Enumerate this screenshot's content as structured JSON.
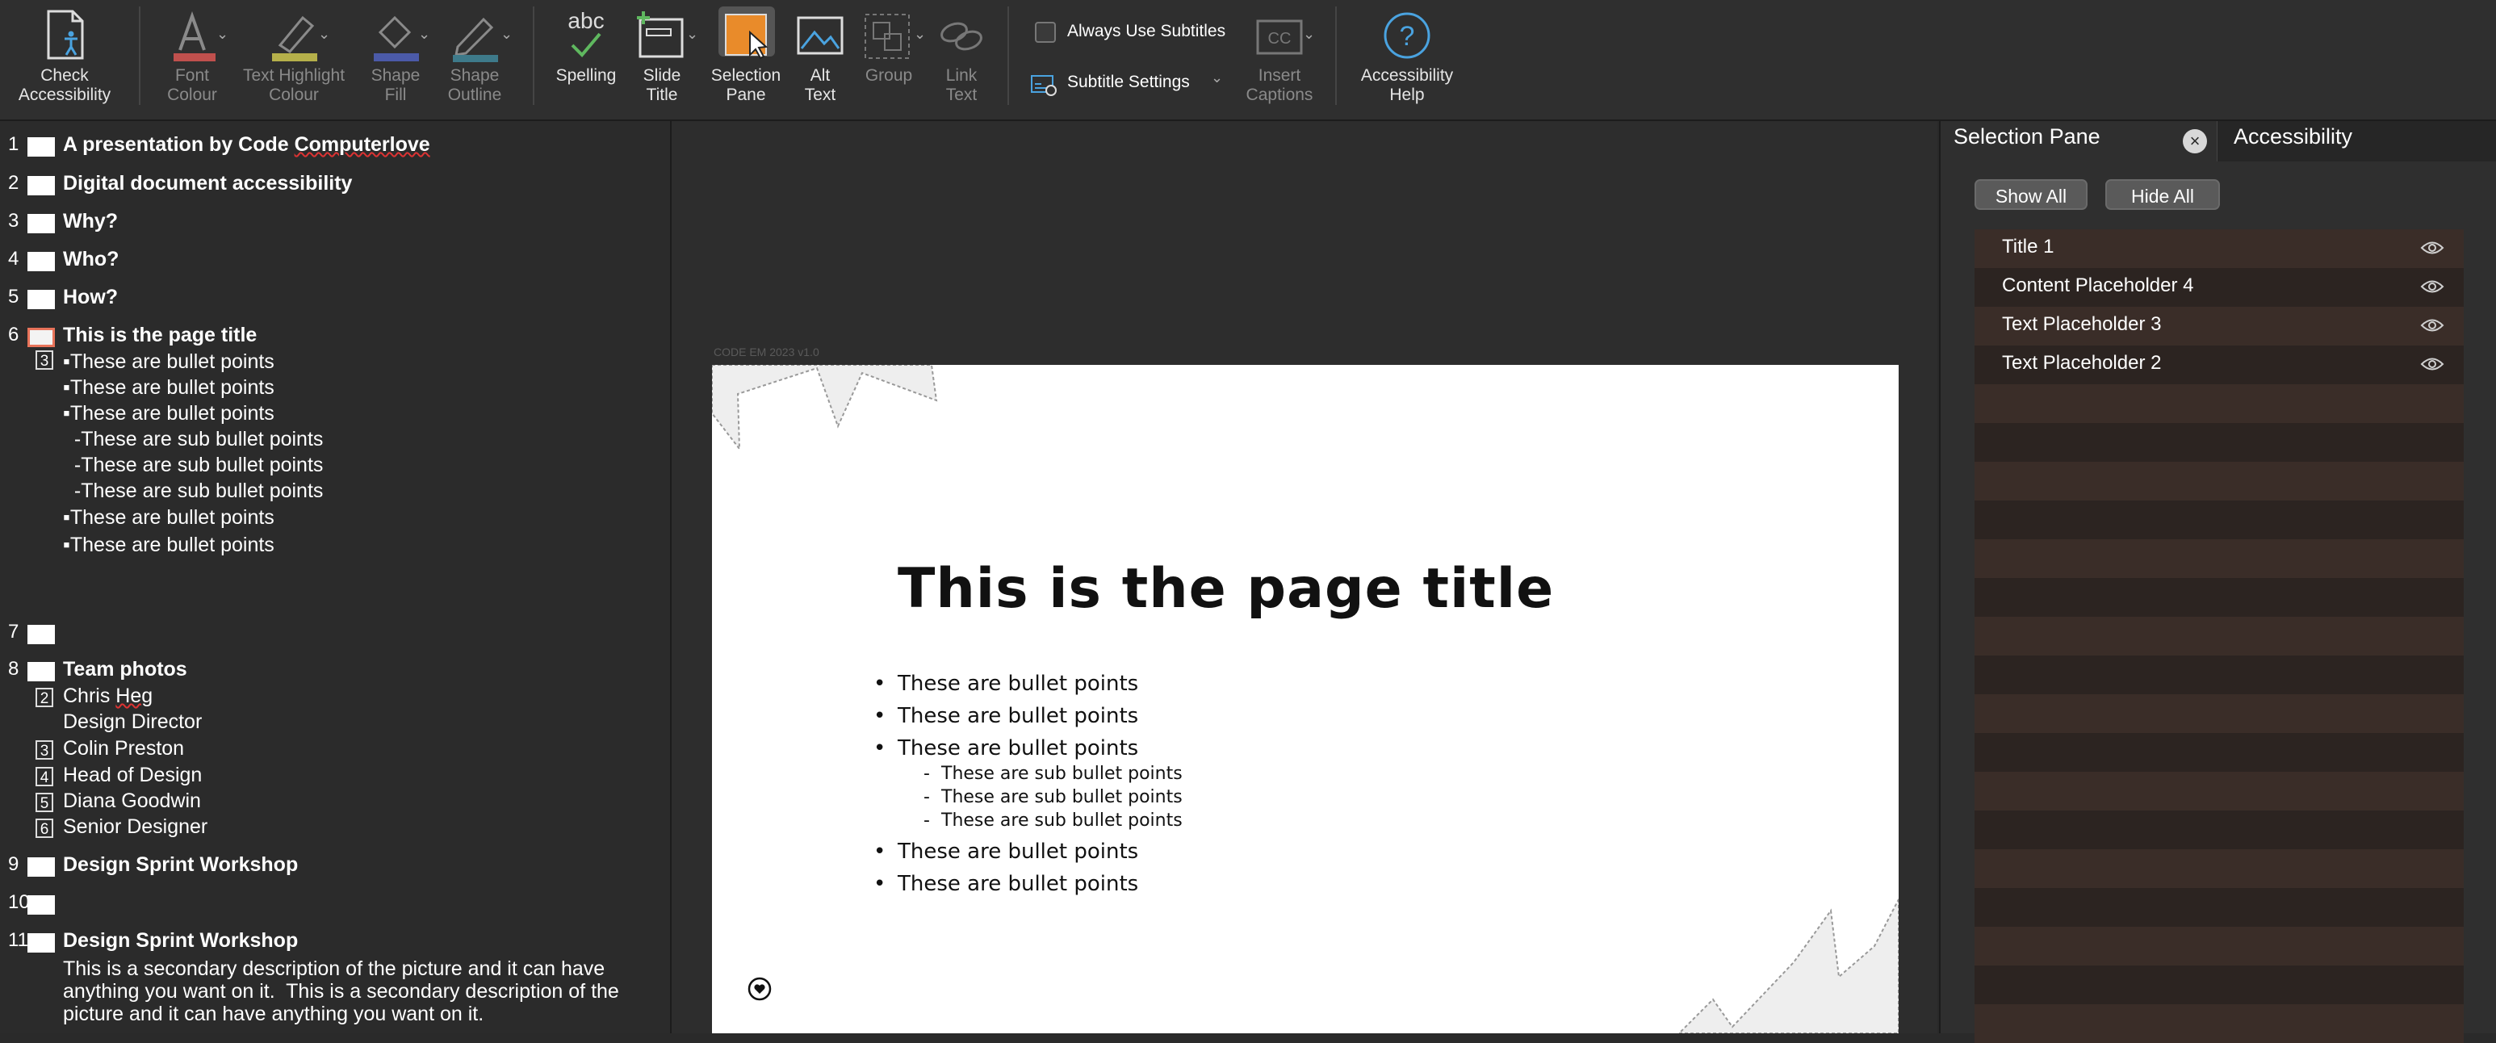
{
  "ribbon": {
    "check_accessibility": "Check\nAccessibility",
    "font_colour": "Font\nColour",
    "text_highlight": "Text Highlight\nColour",
    "shape_fill": "Shape\nFill",
    "shape_outline": "Shape\nOutline",
    "spelling_top": "abc",
    "spelling": "Spelling",
    "slide_title": "Slide\nTitle",
    "selection_pane": "Selection\nPane",
    "alt_text": "Alt\nText",
    "group": "Group",
    "link_text": "Link\nText",
    "always_subtitles": "Always Use Subtitles",
    "subtitle_settings": "Subtitle Settings",
    "insert_captions": "Insert\nCaptions",
    "accessibility_help": "Accessibility\nHelp",
    "colors": {
      "font": "#c0504d",
      "highlight": "#b5b04a",
      "fill": "#4b5aa8",
      "outline": "#3e7a8a"
    }
  },
  "outline": {
    "slides": [
      {
        "num": "1",
        "title": "A presentation by Code Computerlove"
      },
      {
        "num": "2",
        "title": "Digital document accessibility"
      },
      {
        "num": "3",
        "title": "Why?"
      },
      {
        "num": "4",
        "title": "Who?"
      },
      {
        "num": "5",
        "title": "How?"
      },
      {
        "num": "6",
        "title": "This is the page title"
      },
      {
        "num": "7",
        "title": ""
      },
      {
        "num": "8",
        "title": "Team photos"
      },
      {
        "num": "9",
        "title": "Design Sprint Workshop"
      },
      {
        "num": "10",
        "title": ""
      },
      {
        "num": "11",
        "title": "Design Sprint Workshop"
      }
    ],
    "slide6_box": "3",
    "slide6_lines": [
      "▪These are bullet points",
      "▪These are bullet points",
      "▪These are bullet points",
      "  -These are sub bullet points",
      "  -These are sub bullet points",
      "  -These are sub bullet points",
      "▪These are bullet points",
      "▪These are bullet points"
    ],
    "slide8_items": [
      {
        "box": "2",
        "text": "Chris Heg"
      },
      {
        "box": "",
        "text": "Design Director"
      },
      {
        "box": "3",
        "text": "Colin Preston"
      },
      {
        "box": "4",
        "text": "Head of Design"
      },
      {
        "box": "5",
        "text": "Diana Goodwin"
      },
      {
        "box": "6",
        "text": "Senior Designer"
      }
    ],
    "slide11_lines": [
      "This is a secondary description of the picture and it can have",
      "anything you want on it.  This is a secondary description of the",
      "picture and it can have anything you want on it."
    ]
  },
  "slide": {
    "code": "CODE EM 2023 v1.0",
    "title": "This is the page title",
    "bullets": [
      "These are bullet points",
      "These are bullet points",
      "These are bullet points"
    ],
    "sub_bullets": [
      "These are sub bullet points",
      "These are sub bullet points",
      "These are sub bullet points"
    ],
    "bullets_after": [
      "These are bullet points",
      "These are bullet points"
    ]
  },
  "pane": {
    "tab_selection": "Selection Pane",
    "tab_accessibility": "Accessibility",
    "show_all": "Show All",
    "hide_all": "Hide All",
    "items": [
      "Title 1",
      "Content Placeholder 4",
      "Text Placeholder 3",
      "Text Placeholder 2"
    ]
  }
}
